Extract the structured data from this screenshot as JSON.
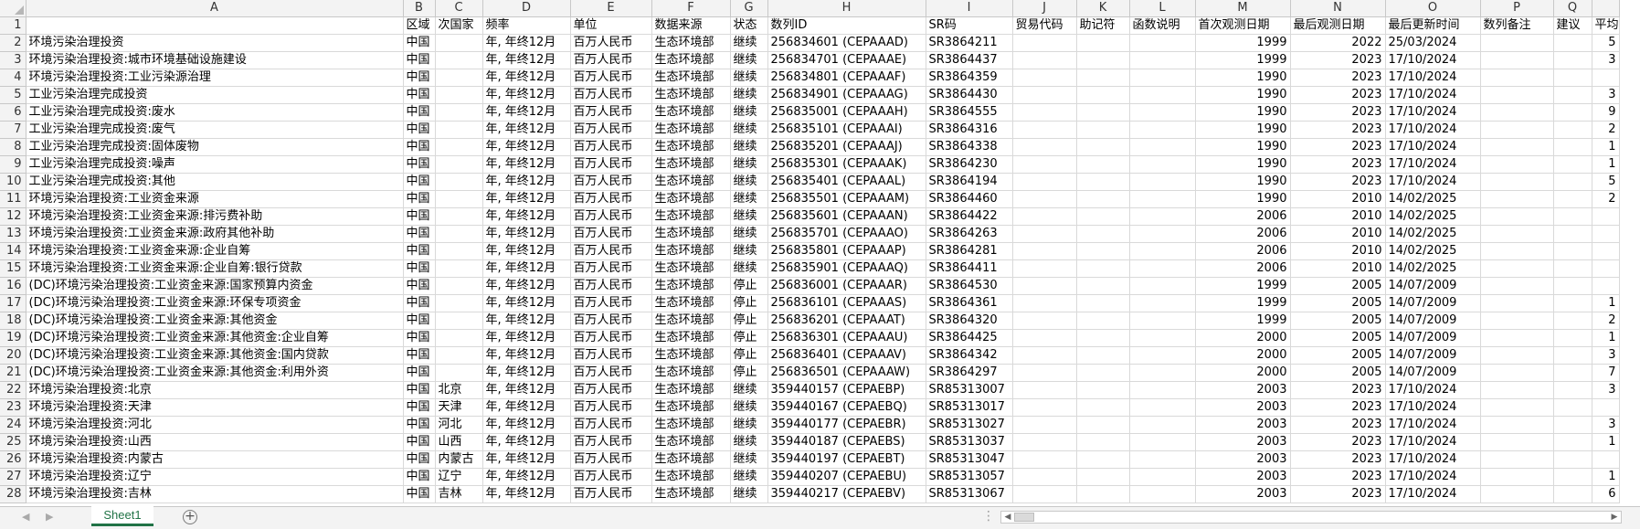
{
  "app": {
    "sheet_tab": "Sheet1",
    "add_sheet_icon": "+"
  },
  "icons": {
    "nav_left": "◀",
    "nav_right": "▶",
    "scroll_left": "◀",
    "scroll_right": "▶",
    "more": "⋮"
  },
  "columns": [
    "A",
    "B",
    "C",
    "D",
    "E",
    "F",
    "G",
    "H",
    "I",
    "J",
    "K",
    "L",
    "M",
    "N",
    "O",
    "P",
    "Q"
  ],
  "header_row": [
    "",
    "区域",
    "次国家",
    "频率",
    "单位",
    "数据来源",
    "状态",
    "数列ID",
    "SR码",
    "贸易代码",
    "助记符",
    "函数说明",
    "首次观测日期",
    "最后观测日期",
    "最后更新时间",
    "数列备注",
    "建议",
    "平均"
  ],
  "rows": [
    [
      "环境污染治理投资",
      "中国",
      "",
      "年, 年终12月",
      "百万人民币",
      "生态环境部",
      "继续",
      "256834601 (CEPAAAD)",
      "SR3864211",
      "",
      "",
      "",
      "1999",
      "2022",
      "25/03/2024",
      "",
      "",
      "5"
    ],
    [
      "环境污染治理投资:城市环境基础设施建设",
      "中国",
      "",
      "年, 年终12月",
      "百万人民币",
      "生态环境部",
      "继续",
      "256834701 (CEPAAAE)",
      "SR3864437",
      "",
      "",
      "",
      "1999",
      "2023",
      "17/10/2024",
      "",
      "",
      "3"
    ],
    [
      "环境污染治理投资:工业污染源治理",
      "中国",
      "",
      "年, 年终12月",
      "百万人民币",
      "生态环境部",
      "继续",
      "256834801 (CEPAAAF)",
      "SR3864359",
      "",
      "",
      "",
      "1990",
      "2023",
      "17/10/2024",
      "",
      "",
      ""
    ],
    [
      "工业污染治理完成投资",
      "中国",
      "",
      "年, 年终12月",
      "百万人民币",
      "生态环境部",
      "继续",
      "256834901 (CEPAAAG)",
      "SR3864430",
      "",
      "",
      "",
      "1990",
      "2023",
      "17/10/2024",
      "",
      "",
      "3"
    ],
    [
      "工业污染治理完成投资:废水",
      "中国",
      "",
      "年, 年终12月",
      "百万人民币",
      "生态环境部",
      "继续",
      "256835001 (CEPAAAH)",
      "SR3864555",
      "",
      "",
      "",
      "1990",
      "2023",
      "17/10/2024",
      "",
      "",
      "9"
    ],
    [
      "工业污染治理完成投资:废气",
      "中国",
      "",
      "年, 年终12月",
      "百万人民币",
      "生态环境部",
      "继续",
      "256835101 (CEPAAAI)",
      "SR3864316",
      "",
      "",
      "",
      "1990",
      "2023",
      "17/10/2024",
      "",
      "",
      "2"
    ],
    [
      "工业污染治理完成投资:固体废物",
      "中国",
      "",
      "年, 年终12月",
      "百万人民币",
      "生态环境部",
      "继续",
      "256835201 (CEPAAAJ)",
      "SR3864338",
      "",
      "",
      "",
      "1990",
      "2023",
      "17/10/2024",
      "",
      "",
      "1"
    ],
    [
      "工业污染治理完成投资:噪声",
      "中国",
      "",
      "年, 年终12月",
      "百万人民币",
      "生态环境部",
      "继续",
      "256835301 (CEPAAAK)",
      "SR3864230",
      "",
      "",
      "",
      "1990",
      "2023",
      "17/10/2024",
      "",
      "",
      "1"
    ],
    [
      "工业污染治理完成投资:其他",
      "中国",
      "",
      "年, 年终12月",
      "百万人民币",
      "生态环境部",
      "继续",
      "256835401 (CEPAAAL)",
      "SR3864194",
      "",
      "",
      "",
      "1990",
      "2023",
      "17/10/2024",
      "",
      "",
      "5"
    ],
    [
      "环境污染治理投资:工业资金来源",
      "中国",
      "",
      "年, 年终12月",
      "百万人民币",
      "生态环境部",
      "继续",
      "256835501 (CEPAAAM)",
      "SR3864460",
      "",
      "",
      "",
      "1990",
      "2010",
      "14/02/2025",
      "",
      "",
      "2"
    ],
    [
      "环境污染治理投资:工业资金来源:排污费补助",
      "中国",
      "",
      "年, 年终12月",
      "百万人民币",
      "生态环境部",
      "继续",
      "256835601 (CEPAAAN)",
      "SR3864422",
      "",
      "",
      "",
      "2006",
      "2010",
      "14/02/2025",
      "",
      "",
      ""
    ],
    [
      "环境污染治理投资:工业资金来源:政府其他补助",
      "中国",
      "",
      "年, 年终12月",
      "百万人民币",
      "生态环境部",
      "继续",
      "256835701 (CEPAAAO)",
      "SR3864263",
      "",
      "",
      "",
      "2006",
      "2010",
      "14/02/2025",
      "",
      "",
      ""
    ],
    [
      "环境污染治理投资:工业资金来源:企业自筹",
      "中国",
      "",
      "年, 年终12月",
      "百万人民币",
      "生态环境部",
      "继续",
      "256835801 (CEPAAAP)",
      "SR3864281",
      "",
      "",
      "",
      "2006",
      "2010",
      "14/02/2025",
      "",
      "",
      ""
    ],
    [
      "环境污染治理投资:工业资金来源:企业自筹:银行贷款",
      "中国",
      "",
      "年, 年终12月",
      "百万人民币",
      "生态环境部",
      "继续",
      "256835901 (CEPAAAQ)",
      "SR3864411",
      "",
      "",
      "",
      "2006",
      "2010",
      "14/02/2025",
      "",
      "",
      ""
    ],
    [
      "(DC)环境污染治理投资:工业资金来源:国家预算内资金",
      "中国",
      "",
      "年, 年终12月",
      "百万人民币",
      "生态环境部",
      "停止",
      "256836001 (CEPAAAR)",
      "SR3864530",
      "",
      "",
      "",
      "1999",
      "2005",
      "14/07/2009",
      "",
      "",
      ""
    ],
    [
      "(DC)环境污染治理投资:工业资金来源:环保专项资金",
      "中国",
      "",
      "年, 年终12月",
      "百万人民币",
      "生态环境部",
      "停止",
      "256836101 (CEPAAAS)",
      "SR3864361",
      "",
      "",
      "",
      "1999",
      "2005",
      "14/07/2009",
      "",
      "",
      "1"
    ],
    [
      "(DC)环境污染治理投资:工业资金来源:其他资金",
      "中国",
      "",
      "年, 年终12月",
      "百万人民币",
      "生态环境部",
      "停止",
      "256836201 (CEPAAAT)",
      "SR3864320",
      "",
      "",
      "",
      "1999",
      "2005",
      "14/07/2009",
      "",
      "",
      "2"
    ],
    [
      "(DC)环境污染治理投资:工业资金来源:其他资金:企业自筹",
      "中国",
      "",
      "年, 年终12月",
      "百万人民币",
      "生态环境部",
      "停止",
      "256836301 (CEPAAAU)",
      "SR3864425",
      "",
      "",
      "",
      "2000",
      "2005",
      "14/07/2009",
      "",
      "",
      "1"
    ],
    [
      "(DC)环境污染治理投资:工业资金来源:其他资金:国内贷款",
      "中国",
      "",
      "年, 年终12月",
      "百万人民币",
      "生态环境部",
      "停止",
      "256836401 (CEPAAAV)",
      "SR3864342",
      "",
      "",
      "",
      "2000",
      "2005",
      "14/07/2009",
      "",
      "",
      "3"
    ],
    [
      "(DC)环境污染治理投资:工业资金来源:其他资金:利用外资",
      "中国",
      "",
      "年, 年终12月",
      "百万人民币",
      "生态环境部",
      "停止",
      "256836501 (CEPAAAW)",
      "SR3864297",
      "",
      "",
      "",
      "2000",
      "2005",
      "14/07/2009",
      "",
      "",
      "7"
    ],
    [
      "环境污染治理投资:北京",
      "中国",
      "北京",
      "年, 年终12月",
      "百万人民币",
      "生态环境部",
      "继续",
      "359440157 (CEPAEBP)",
      "SR85313007",
      "",
      "",
      "",
      "2003",
      "2023",
      "17/10/2024",
      "",
      "",
      "3"
    ],
    [
      "环境污染治理投资:天津",
      "中国",
      "天津",
      "年, 年终12月",
      "百万人民币",
      "生态环境部",
      "继续",
      "359440167 (CEPAEBQ)",
      "SR85313017",
      "",
      "",
      "",
      "2003",
      "2023",
      "17/10/2024",
      "",
      "",
      ""
    ],
    [
      "环境污染治理投资:河北",
      "中国",
      "河北",
      "年, 年终12月",
      "百万人民币",
      "生态环境部",
      "继续",
      "359440177 (CEPAEBR)",
      "SR85313027",
      "",
      "",
      "",
      "2003",
      "2023",
      "17/10/2024",
      "",
      "",
      "3"
    ],
    [
      "环境污染治理投资:山西",
      "中国",
      "山西",
      "年, 年终12月",
      "百万人民币",
      "生态环境部",
      "继续",
      "359440187 (CEPAEBS)",
      "SR85313037",
      "",
      "",
      "",
      "2003",
      "2023",
      "17/10/2024",
      "",
      "",
      "1"
    ],
    [
      "环境污染治理投资:内蒙古",
      "中国",
      "内蒙古",
      "年, 年终12月",
      "百万人民币",
      "生态环境部",
      "继续",
      "359440197 (CEPAEBT)",
      "SR85313047",
      "",
      "",
      "",
      "2003",
      "2023",
      "17/10/2024",
      "",
      "",
      ""
    ],
    [
      "环境污染治理投资:辽宁",
      "中国",
      "辽宁",
      "年, 年终12月",
      "百万人民币",
      "生态环境部",
      "继续",
      "359440207 (CEPAEBU)",
      "SR85313057",
      "",
      "",
      "",
      "2003",
      "2023",
      "17/10/2024",
      "",
      "",
      "1"
    ],
    [
      "环境污染治理投资:吉林",
      "中国",
      "吉林",
      "年, 年终12月",
      "百万人民币",
      "生态环境部",
      "继续",
      "359440217 (CEPAEBV)",
      "SR85313067",
      "",
      "",
      "",
      "2003",
      "2023",
      "17/10/2024",
      "",
      "",
      "6"
    ]
  ]
}
